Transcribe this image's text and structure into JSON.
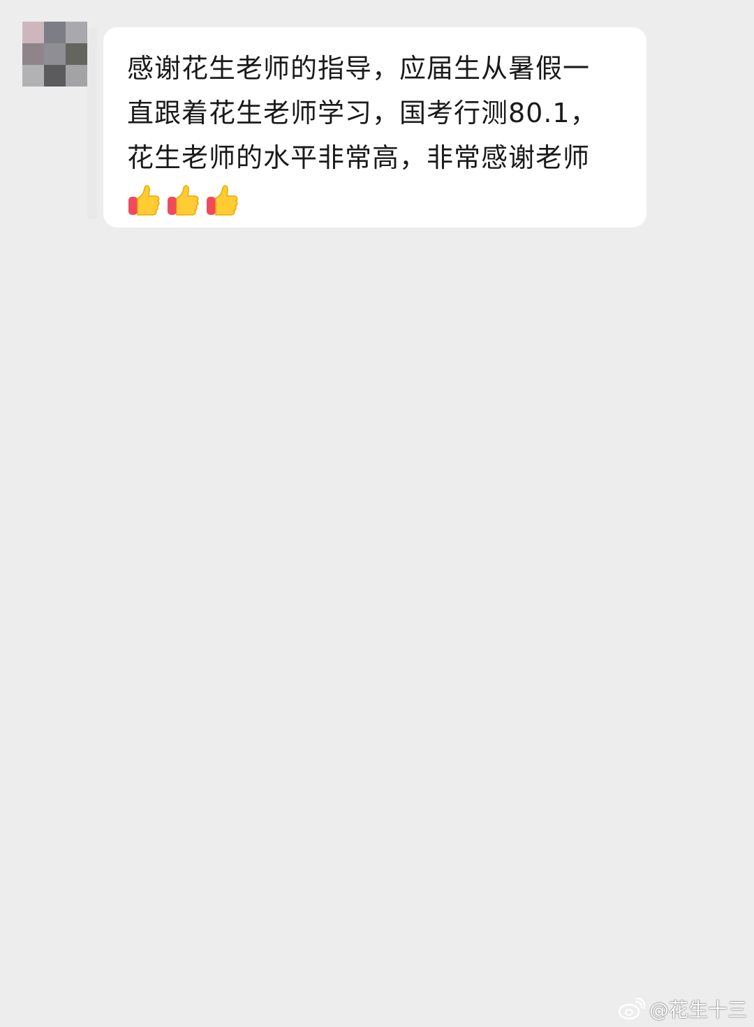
{
  "message": {
    "lines": [
      "感谢花生老师的指导，应届生从暑假一",
      "直跟着花生老师学习，国考行测80.1，",
      "花生老师的水平非常高，非常感谢老师"
    ],
    "emojis": [
      "thumbs-up-icon",
      "thumbs-up-icon",
      "thumbs-up-icon"
    ]
  },
  "avatar": {
    "pixels": [
      "#cdb7bd",
      "#7d7d86",
      "#a9a9ad",
      "#8f8489",
      "#8e8e94",
      "#65655f",
      "#b2b1b3",
      "#5b5a5c",
      "#a3a3a6"
    ]
  },
  "watermark": {
    "text": "@花生十三"
  },
  "colors": {
    "background": "#ededed",
    "bubble": "#ffffff",
    "text": "#1a1a1a"
  }
}
